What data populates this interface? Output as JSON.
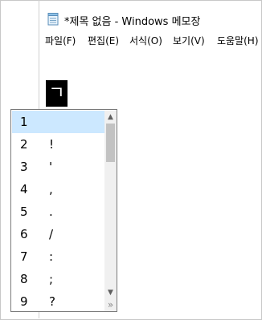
{
  "window": {
    "title": "*제목 없음 - Windows 메모장"
  },
  "menubar": {
    "items": [
      "파일(F)",
      "편집(E)",
      "서식(O)",
      "보기(V)",
      "도움말(H)"
    ]
  },
  "editor": {
    "composing_char": "ㄱ"
  },
  "candidates": {
    "selected_index": 0,
    "items": [
      {
        "num": "1",
        "char": ""
      },
      {
        "num": "2",
        "char": "!"
      },
      {
        "num": "3",
        "char": "'"
      },
      {
        "num": "4",
        "char": ","
      },
      {
        "num": "5",
        "char": "."
      },
      {
        "num": "6",
        "char": "/"
      },
      {
        "num": "7",
        "char": ":"
      },
      {
        "num": "8",
        "char": ";"
      },
      {
        "num": "9",
        "char": "?"
      }
    ],
    "scroll_up_icon": "▲",
    "scroll_down_icon": "▼",
    "expand_icon": "»"
  },
  "colors": {
    "selection": "#cce8ff",
    "composing_bg": "#000000"
  }
}
